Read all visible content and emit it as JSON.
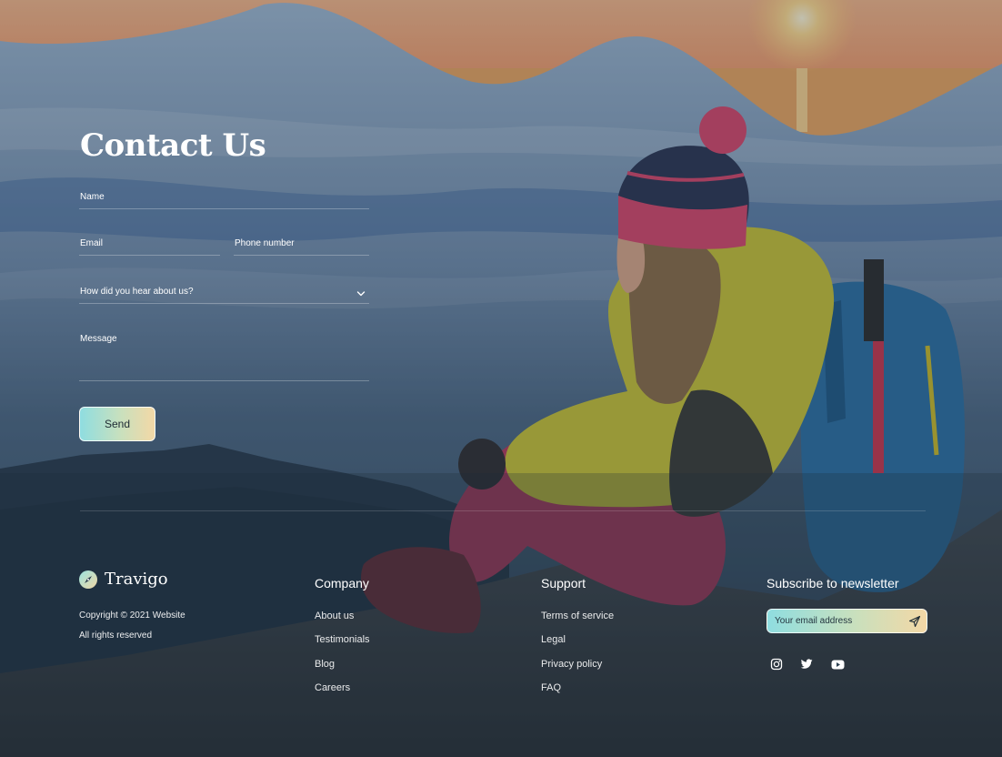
{
  "contact": {
    "title": "Contact Us",
    "fields": {
      "name_label": "Name",
      "email_label": "Email",
      "phone_label": "Phone number",
      "source_placeholder": "How did you hear about us?",
      "message_label": "Message"
    },
    "send_label": "Send"
  },
  "footer": {
    "brand": "Travigo",
    "copyright": "Copyright © 2021 Website",
    "rights": "All rights reserved",
    "company": {
      "heading": "Company",
      "links": [
        "About us",
        "Testimonials",
        "Blog",
        "Careers"
      ]
    },
    "support": {
      "heading": "Support",
      "links": [
        "Terms of service",
        "Legal",
        "Privacy policy",
        "FAQ"
      ]
    },
    "newsletter": {
      "heading": "Subscribe to newsletter",
      "placeholder": "Your email address"
    },
    "social_icons": [
      "instagram-icon",
      "twitter-icon",
      "youtube-icon"
    ]
  },
  "colors": {
    "accent_start": "#8fdde0",
    "accent_end": "#f3d8a6",
    "overlay": "#2d4152"
  }
}
